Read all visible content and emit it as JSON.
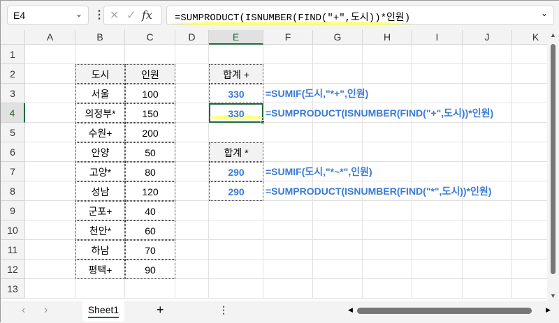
{
  "formula_bar": {
    "name_box": "E4",
    "formula": "=SUMPRODUCT(ISNUMBER(FIND(\"+\",도시))*인원)",
    "cancel_icon": "✕",
    "enter_icon": "✓",
    "fx": "fx"
  },
  "columns": [
    "A",
    "B",
    "C",
    "D",
    "E",
    "F",
    "G",
    "H",
    "I",
    "J",
    "K"
  ],
  "rows": [
    "1",
    "2",
    "3",
    "4",
    "5",
    "6",
    "7",
    "8",
    "9",
    "10",
    "11",
    "12",
    "13"
  ],
  "table": {
    "headers": [
      "도시",
      "인원"
    ],
    "rows": [
      [
        "서울",
        "100"
      ],
      [
        "의정부*",
        "150"
      ],
      [
        "수원+",
        "200"
      ],
      [
        "안양",
        "50"
      ],
      [
        "고양*",
        "80"
      ],
      [
        "성남",
        "120"
      ],
      [
        "군포+",
        "40"
      ],
      [
        "천안*",
        "60"
      ],
      [
        "하남",
        "70"
      ],
      [
        "평택+",
        "90"
      ]
    ]
  },
  "sum_plus": {
    "label": "합계 +",
    "v1": "330",
    "f1": "=SUMIF(도시,\"*+\",인원)",
    "v2": "330",
    "f2": "=SUMPRODUCT(ISNUMBER(FIND(\"+\",도시))*인원)"
  },
  "sum_star": {
    "label": "합계 *",
    "v1": "290",
    "f1": "=SUMIF(도시,\"*~*\",인원)",
    "v2": "290",
    "f2": "=SUMPRODUCT(ISNUMBER(FIND(\"*\",도시))*인원)"
  },
  "sheet_tabs": {
    "active": "Sheet1",
    "add": "+",
    "prev": "‹",
    "next": "›"
  },
  "colors": {
    "accent": "#1e6b3c",
    "formula_text": "#3a7bd5",
    "highlight": "#ffff6a"
  }
}
